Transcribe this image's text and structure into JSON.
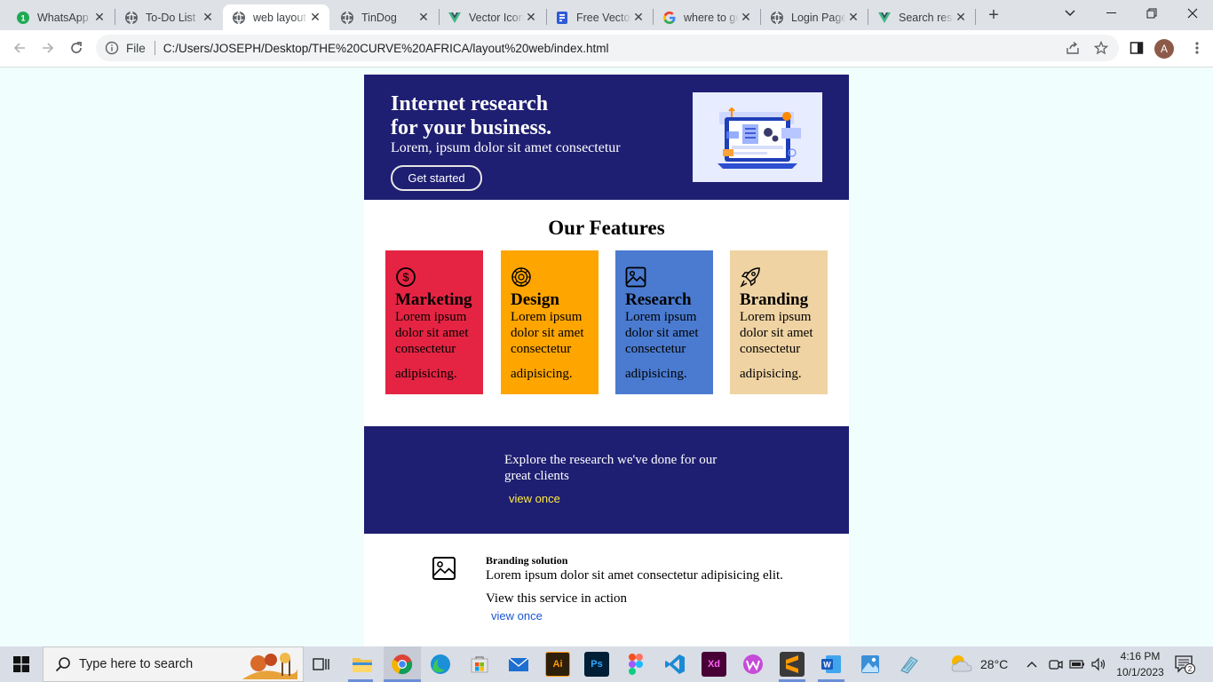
{
  "browser": {
    "tabs": [
      {
        "label": "WhatsApp",
        "icon": "whatsapp-icon"
      },
      {
        "label": "To-Do List",
        "icon": "globe-icon"
      },
      {
        "label": "web layout",
        "icon": "globe-icon",
        "active": true
      },
      {
        "label": "TinDog",
        "icon": "globe-icon"
      },
      {
        "label": "Vector Icons",
        "icon": "vue-icon"
      },
      {
        "label": "Free Vector",
        "icon": "docs-icon"
      },
      {
        "label": "where to get",
        "icon": "google-icon"
      },
      {
        "label": "Login Page",
        "icon": "globe-icon"
      },
      {
        "label": "Search results",
        "icon": "vue-icon"
      }
    ],
    "whatsapp_badge": "1",
    "file_label": "File",
    "url": "C:/Users/JOSEPH/Desktop/THE%20CURVE%20AFRICA/layout%20web/index.html",
    "profile_initial": "A"
  },
  "hero": {
    "title_line1": "Internet research",
    "title_line2": "for your business.",
    "subtitle": "Lorem, ipsum dolor sit amet consectetur",
    "cta_label": "Get started"
  },
  "features": {
    "title": "Our Features",
    "cards": [
      {
        "title": "Marketing",
        "text": "Lorem ipsum dolor sit amet consectetur",
        "text2": "adipisicing.",
        "color": "#e52443",
        "icon": "dollar-circle-icon"
      },
      {
        "title": "Design",
        "text": "Lorem ipsum dolor sit amet consectetur",
        "text2": "adipisicing.",
        "color": "#ffa500",
        "icon": "palette-icon"
      },
      {
        "title": "Research",
        "text": "Lorem ipsum dolor sit amet consectetur",
        "text2": "adipisicing.",
        "color": "#4a7bd0",
        "icon": "image-icon"
      },
      {
        "title": "Branding",
        "text": "Lorem ipsum dolor sit amet consectetur",
        "text2": "adipisicing.",
        "color": "#f0d3a3",
        "icon": "rocket-icon"
      }
    ]
  },
  "explore": {
    "text": "Explore the research we've done for our great clients",
    "link": "view once"
  },
  "service": {
    "title": "Branding solution",
    "description": "Lorem ipsum dolor sit amet consectetur adipisicing elit.",
    "action_text": "View this service in action",
    "link": "view once"
  },
  "taskbar": {
    "search_placeholder": "Type here to search",
    "weather": "28°C",
    "time": "4:16 PM",
    "date": "10/1/2023",
    "notifications": "2"
  },
  "colors": {
    "navy": "#1e1e72",
    "page_bg": "#f0fefe",
    "link_yellow": "#ffec3d",
    "link_blue": "#1a56d6"
  }
}
